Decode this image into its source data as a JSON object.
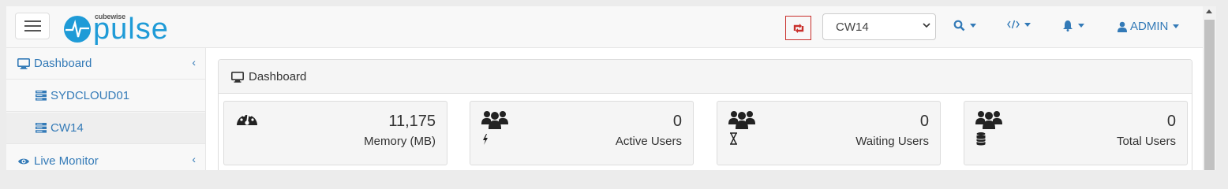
{
  "app": {
    "logo_small": "cubewise",
    "logo_big": "pulse"
  },
  "header": {
    "server_select": "CW14",
    "user_label": "ADMIN",
    "colors": {
      "accent": "#337ab7",
      "refresh_border": "#c9302c",
      "logo_blue": "#1f9bd7"
    }
  },
  "sidebar": {
    "items": [
      {
        "label": "Dashboard",
        "icon": "desktop-icon"
      },
      {
        "label": "SYDCLOUD01",
        "icon": "server-icon"
      },
      {
        "label": "CW14",
        "icon": "server-icon"
      },
      {
        "label": "Live Monitor",
        "icon": "eye-icon"
      }
    ]
  },
  "main": {
    "panel_title": "Dashboard",
    "cards": [
      {
        "value": "11,175",
        "label": "Memory (MB)",
        "icon": "tachometer-icon"
      },
      {
        "value": "0",
        "label": "Active Users",
        "icon": "users-bolt-icon"
      },
      {
        "value": "0",
        "label": "Waiting Users",
        "icon": "users-hourglass-icon"
      },
      {
        "value": "0",
        "label": "Total Users",
        "icon": "users-database-icon"
      }
    ]
  }
}
